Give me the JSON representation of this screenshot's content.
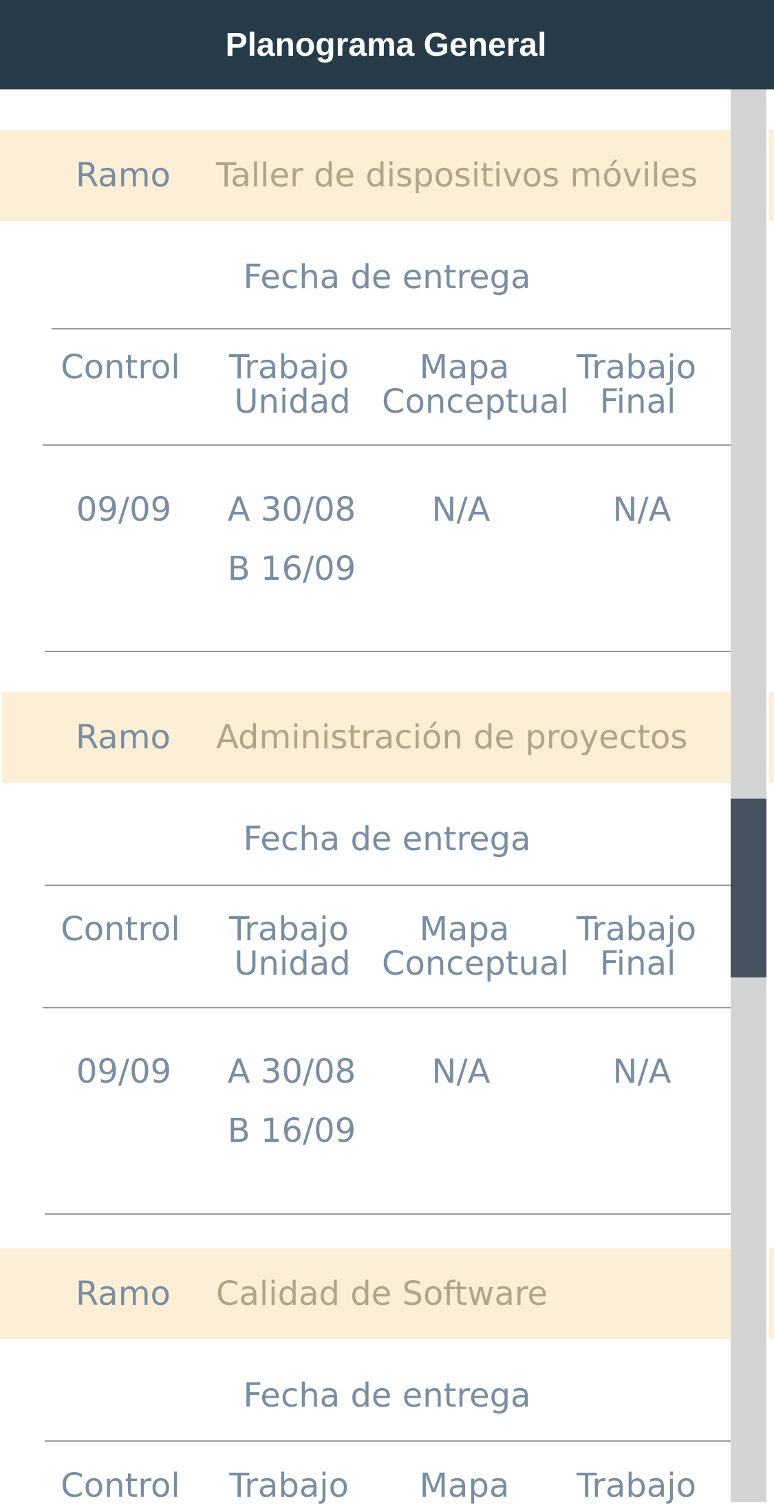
{
  "header": {
    "title": "Planograma General"
  },
  "labels": {
    "ramo": "Ramo",
    "fecha_entrega": "Fecha de entrega",
    "columns": {
      "control": "Control",
      "trabajo_unidad_l1": "Trabajo",
      "trabajo_unidad_l2": "Unidad",
      "mapa_l1": "Mapa",
      "mapa_l2": "Conceptual",
      "trabajo_final_l1": "Trabajo",
      "trabajo_final_l2": "Final"
    }
  },
  "courses": [
    {
      "name": "Taller de dispositivos móviles",
      "control": "09/09",
      "trabajo_unidad_a": "A 30/08",
      "trabajo_unidad_b": "B 16/09",
      "mapa_conceptual": "N/A",
      "trabajo_final": "N/A"
    },
    {
      "name": "Administración de proyectos",
      "control": "09/09",
      "trabajo_unidad_a": "A 30/08",
      "trabajo_unidad_b": "B 16/09",
      "mapa_conceptual": "N/A",
      "trabajo_final": "N/A"
    },
    {
      "name": "Calidad de Software"
    }
  ]
}
